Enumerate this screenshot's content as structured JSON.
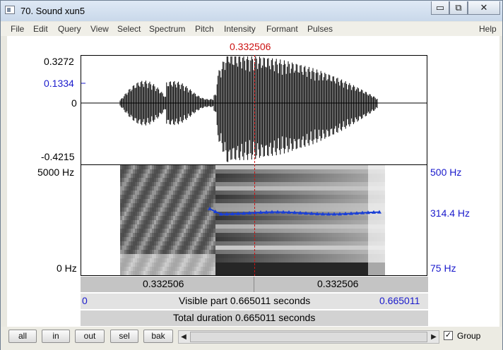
{
  "window": {
    "title": "70. Sound xun5",
    "minimize": "▭",
    "restore": "⧉",
    "close": "✕"
  },
  "menu": [
    "File",
    "Edit",
    "Query",
    "View",
    "Select",
    "Spectrum",
    "Pitch",
    "Intensity",
    "Formant",
    "Pulses",
    "Help"
  ],
  "cursor": {
    "time_label": "0.332506"
  },
  "waveform": {
    "y_max": "0.3272",
    "y_marker": "0.1334",
    "y_zero": "0",
    "y_min": "-0.4215"
  },
  "spectrogram": {
    "freq_top_left": "5000 Hz",
    "freq_bottom_left": "0 Hz",
    "pitch_top_right": "500 Hz",
    "pitch_current_right": "314.4 Hz",
    "pitch_bottom_right": "75 Hz"
  },
  "time_bar": {
    "left": "0.332506",
    "right": "0.332506"
  },
  "visible_bar": {
    "start": "0",
    "text": "Visible part 0.665011 seconds",
    "end": "0.665011"
  },
  "total_bar": {
    "text": "Total duration 0.665011 seconds"
  },
  "buttons": {
    "all": "all",
    "in": "in",
    "out": "out",
    "sel": "sel",
    "bak": "bak"
  },
  "group": {
    "label": "Group",
    "checked": "✓"
  },
  "colors": {
    "waveform": "#000000",
    "pitch": "#1a3fd6",
    "cursor": "#cc1111",
    "axis_label_blue": "#1a1acc"
  }
}
